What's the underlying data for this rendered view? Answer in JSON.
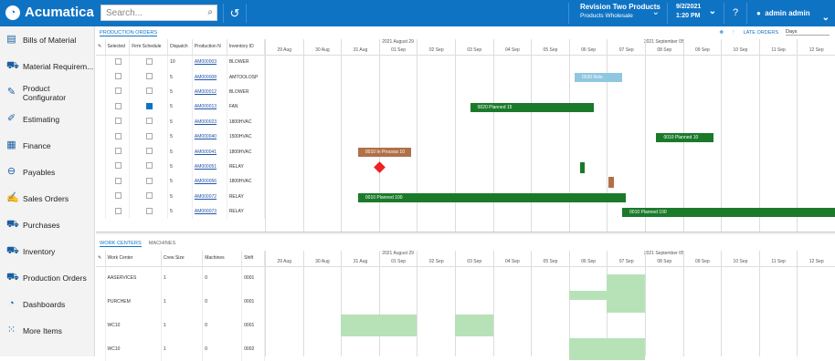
{
  "topbar": {
    "brand": "Acumatica",
    "search_placeholder": "Search...",
    "company": "Revision Two Products",
    "branch": "Products Wholesale",
    "date": "9/2/2021",
    "time": "1:20 PM",
    "user": "admin admin"
  },
  "sidebar": [
    {
      "label": "Bills of Material",
      "icon": "document-icon"
    },
    {
      "label": "Material Requirem...",
      "icon": "cart-icon"
    },
    {
      "label": "Product Configurator",
      "icon": "wrench-icon"
    },
    {
      "label": "Estimating",
      "icon": "pencil-icon"
    },
    {
      "label": "Finance",
      "icon": "calculator-icon"
    },
    {
      "label": "Payables",
      "icon": "minus-circle-icon"
    },
    {
      "label": "Sales Orders",
      "icon": "edit-icon"
    },
    {
      "label": "Purchases",
      "icon": "cart-icon"
    },
    {
      "label": "Inventory",
      "icon": "truck-icon"
    },
    {
      "label": "Production Orders",
      "icon": "truck-icon"
    },
    {
      "label": "Dashboards",
      "icon": "gauge-icon"
    },
    {
      "label": "More Items",
      "icon": "grid-icon"
    }
  ],
  "top": {
    "tab": "PRODUCTION ORDERS",
    "late_orders": "LATE ORDERS",
    "view": "Days",
    "columns": [
      "Selected",
      "Firm Schedule",
      "Dispatch",
      "Production N",
      "Inventory ID"
    ],
    "rows": [
      {
        "dispatch": "10",
        "prod": "AM000003",
        "inv": "BLOWER",
        "firm": false
      },
      {
        "dispatch": "5",
        "prod": "AM000008",
        "inv": "AMTOOLOSP",
        "firm": false
      },
      {
        "dispatch": "5",
        "prod": "AM000012",
        "inv": "BLOWER",
        "firm": false
      },
      {
        "dispatch": "5",
        "prod": "AM000013",
        "inv": "FAN",
        "firm": true
      },
      {
        "dispatch": "5",
        "prod": "AM000023",
        "inv": "1800HVAC",
        "firm": false
      },
      {
        "dispatch": "5",
        "prod": "AM000040",
        "inv": "1500HVAC",
        "firm": false
      },
      {
        "dispatch": "5",
        "prod": "AM000041",
        "inv": "1800HVAC",
        "firm": false
      },
      {
        "dispatch": "5",
        "prod": "AM000051",
        "inv": "RELAY",
        "firm": false
      },
      {
        "dispatch": "5",
        "prod": "AM000056",
        "inv": "1800HVAC",
        "firm": false
      },
      {
        "dispatch": "5",
        "prod": "AM000072",
        "inv": "RELAY",
        "firm": false
      },
      {
        "dispatch": "5",
        "prod": "AM000073",
        "inv": "RELAY",
        "firm": false
      }
    ],
    "week1": "2021 August 29",
    "week2": "2021 September 05",
    "days": [
      "29 Aug",
      "30 Aug",
      "31 Aug",
      "01 Sep",
      "02 Sep",
      "03 Sep",
      "04 Sep",
      "05 Sep",
      "06 Sep",
      "07 Sep",
      "08 Sep",
      "09 Sep",
      "10 Sep",
      "11 Sep",
      "12 Sep"
    ],
    "bars": [
      {
        "label": "0020 Relo",
        "row": 1,
        "start": 8.15,
        "len": 1.25,
        "color": "#8fc6e0",
        "pre": "0"
      },
      {
        "label": "0020 Planned 15",
        "row": 3,
        "start": 5.4,
        "len": 3.25,
        "color": "#1a7a2a"
      },
      {
        "label": "0010 Planned 10",
        "row": 5,
        "start": 10.3,
        "len": 1.5,
        "color": "#1a7a2a"
      },
      {
        "label": "0010 In Process 10",
        "row": 6,
        "start": 2.45,
        "len": 1.4,
        "color": "#b07048"
      },
      {
        "label": "0010 Planned 100",
        "row": 9,
        "start": 2.45,
        "len": 7.05,
        "color": "#1a7a2a"
      },
      {
        "label": "0010 Planned 100",
        "row": 10,
        "start": 9.4,
        "len": 5.6,
        "color": "#1a7a2a"
      }
    ]
  },
  "bottom": {
    "tab1": "WORK CENTERS",
    "tab2": "MACHINES",
    "columns": [
      "Work Center",
      "Crew Size",
      "Machines",
      "Shift"
    ],
    "rows": [
      {
        "wc": "AASERVICES",
        "crew": "1",
        "mach": "0",
        "shift": "0001"
      },
      {
        "wc": "PURCHEM",
        "crew": "1",
        "mach": "0",
        "shift": "0001"
      },
      {
        "wc": "WC10",
        "crew": "1",
        "mach": "0",
        "shift": "0001"
      },
      {
        "wc": "WC10",
        "crew": "1",
        "mach": "0",
        "shift": "0002"
      }
    ]
  }
}
